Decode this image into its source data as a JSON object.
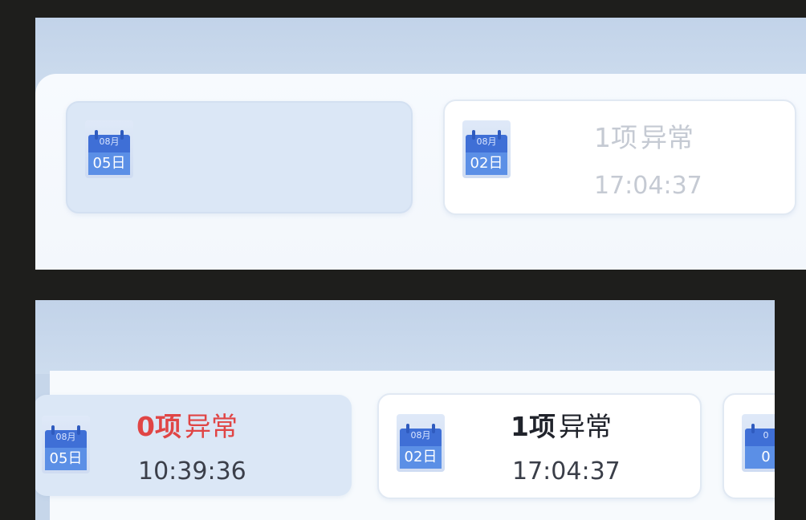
{
  "colors": {
    "background": "#1e1e1c",
    "header_band": "#c6d6ea",
    "content_area": "#f6f9fd",
    "selected_card": "#dbe7f6",
    "calendar_blue": "#3f6fd6",
    "alert_red": "#e04545"
  },
  "top_panel": {
    "cards": [
      {
        "state": "selected",
        "icon": "calendar-icon",
        "day": "05日",
        "month": "08月",
        "count": "",
        "label": "",
        "time": ""
      },
      {
        "state": "faded",
        "icon": "calendar-icon",
        "day": "02日",
        "month": "08月",
        "count": "1项",
        "label": "异常",
        "time": "17:04:37"
      }
    ]
  },
  "bottom_panel": {
    "cards": [
      {
        "state": "selected-alert",
        "icon": "calendar-icon",
        "day": "05日",
        "month": "08月",
        "count": "0项",
        "label": "异常",
        "time": "10:39:36"
      },
      {
        "state": "normal",
        "icon": "calendar-icon",
        "day": "02日",
        "month": "08月",
        "count": "1项",
        "label": "异常",
        "time": "17:04:37"
      },
      {
        "state": "partial",
        "icon": "calendar-icon",
        "day": "0",
        "month": "0"
      }
    ]
  }
}
